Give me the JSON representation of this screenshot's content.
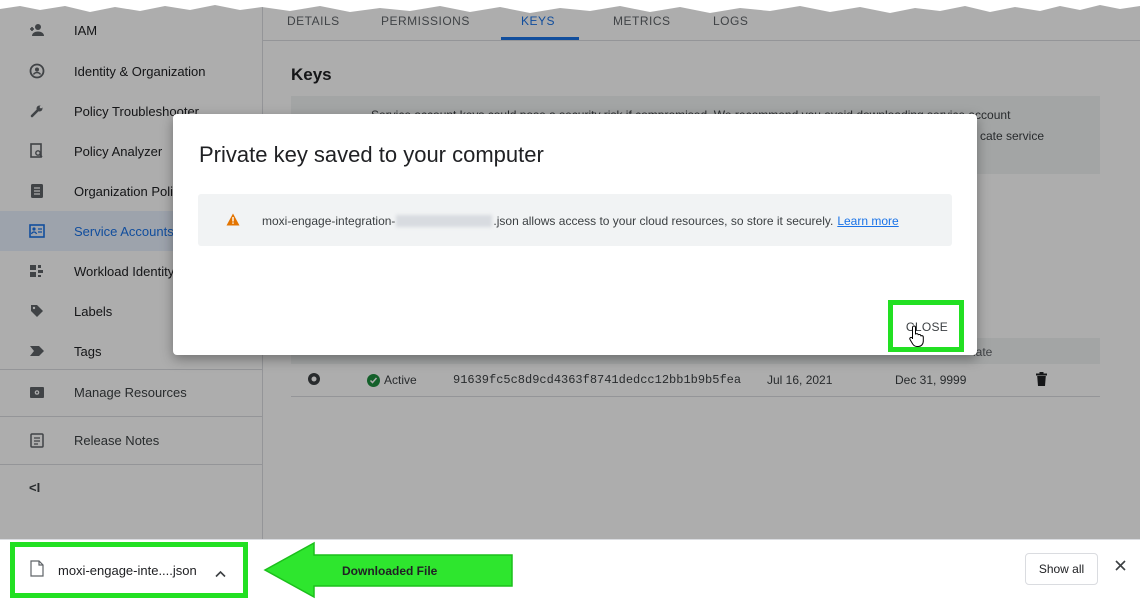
{
  "sidebar": {
    "items": [
      {
        "label": "IAM",
        "icon": "person-add-icon"
      },
      {
        "label": "Identity & Organization",
        "icon": "account-circle-icon"
      },
      {
        "label": "Policy Troubleshooter",
        "icon": "wrench-icon"
      },
      {
        "label": "Policy Analyzer",
        "icon": "document-search-icon"
      },
      {
        "label": "Organization Poli",
        "icon": "list-doc-icon"
      },
      {
        "label": "Service Accounts",
        "icon": "service-account-icon"
      },
      {
        "label": "Workload Identity",
        "icon": "workload-grid-icon"
      },
      {
        "label": "Labels",
        "icon": "tag-icon"
      },
      {
        "label": "Tags",
        "icon": "tag-arrow-icon"
      }
    ],
    "manage_resources": "Manage Resources",
    "release_notes": "Release Notes",
    "collapse": "<I"
  },
  "tabs": [
    {
      "label": "DETAILS"
    },
    {
      "label": "PERMISSIONS"
    },
    {
      "label": "KEYS"
    },
    {
      "label": "METRICS"
    },
    {
      "label": "LOGS"
    }
  ],
  "main": {
    "heading": "Keys",
    "banner_line1": "Service account keys could pose a security risk if compromised. We recommend you avoid downloading service account",
    "banner_line2": "cate service"
  },
  "table": {
    "expire_header_partial": "late",
    "row": {
      "status": "Active",
      "key_id": "91639fc5c8d9cd4363f8741dedcc12bb1b9b5fea",
      "created": "Jul 16, 2021",
      "expires": "Dec 31, 9999"
    }
  },
  "dialog": {
    "title": "Private key saved to your computer",
    "msg_prefix": "moxi-engage-integration-",
    "msg_suffix": ".json allows access to your cloud resources, so store it securely.",
    "learn_more": "Learn more",
    "close": "CLOSE"
  },
  "download_bar": {
    "filename": "moxi-engage-inte....json",
    "annotation": "Downloaded File",
    "show_all": "Show all"
  },
  "colors": {
    "accent": "#1a73e8",
    "highlight": "#22e022",
    "warning": "#e37400",
    "active_green": "#1e8e3e"
  }
}
